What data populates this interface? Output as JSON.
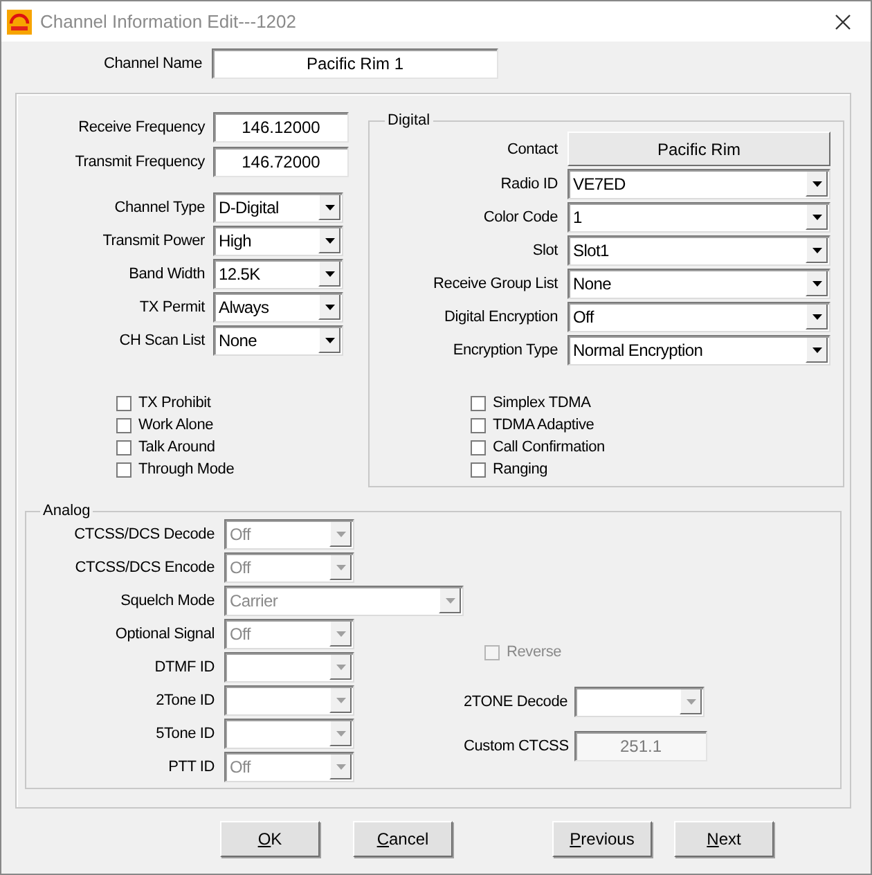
{
  "window": {
    "title": "Channel Information Edit---1202"
  },
  "channel_name": {
    "label": "Channel Name",
    "value": "Pacific Rim 1"
  },
  "frequencies": [
    {
      "label": "Receive Frequency",
      "value": "146.12000"
    },
    {
      "label": "Transmit Frequency",
      "value": "146.72000"
    }
  ],
  "general": [
    {
      "label": "Channel Type",
      "value": "D-Digital"
    },
    {
      "label": "Transmit Power",
      "value": "High"
    },
    {
      "label": "Band Width",
      "value": "12.5K"
    },
    {
      "label": "TX Permit",
      "value": "Always"
    },
    {
      "label": "CH Scan List",
      "value": "None"
    }
  ],
  "general_options": [
    {
      "label": "TX Prohibit",
      "checked": false
    },
    {
      "label": "Work Alone",
      "checked": false
    },
    {
      "label": "Talk Around",
      "checked": false
    },
    {
      "label": "Through Mode",
      "checked": false
    }
  ],
  "digital": {
    "title": "Digital",
    "contact": {
      "label": "Contact",
      "value": "Pacific Rim"
    },
    "fields": [
      {
        "label": "Radio ID",
        "value": "VE7ED"
      },
      {
        "label": "Color Code",
        "value": "1"
      },
      {
        "label": "Slot",
        "value": "Slot1"
      },
      {
        "label": "Receive Group List",
        "value": "None"
      },
      {
        "label": "Digital Encryption",
        "value": "Off"
      },
      {
        "label": "Encryption Type",
        "value": "Normal Encryption"
      }
    ],
    "options": [
      {
        "label": "Simplex TDMA",
        "checked": false
      },
      {
        "label": "TDMA Adaptive",
        "checked": false
      },
      {
        "label": "Call Confirmation",
        "checked": false
      },
      {
        "label": "Ranging",
        "checked": false
      }
    ]
  },
  "analog": {
    "title": "Analog",
    "fields": [
      {
        "label": "CTCSS/DCS Decode",
        "value": "Off",
        "kind": "combo",
        "disabled": true
      },
      {
        "label": "CTCSS/DCS Encode",
        "value": "Off",
        "kind": "combo",
        "disabled": true
      },
      {
        "label": "Squelch Mode",
        "value": "Carrier",
        "kind": "wide",
        "disabled": true
      },
      {
        "label": "Optional Signal",
        "value": "Off",
        "kind": "combo",
        "disabled": true
      },
      {
        "label": "DTMF ID",
        "kind": "combo",
        "disabled": true
      },
      {
        "label": "2Tone ID",
        "kind": "combo",
        "disabled": true
      },
      {
        "label": "5Tone ID",
        "kind": "combo",
        "disabled": true
      },
      {
        "label": "PTT ID",
        "value": "Off",
        "kind": "combo",
        "disabled": true
      }
    ],
    "reverse": {
      "label": "Reverse",
      "checked": false,
      "disabled": true
    },
    "two_tone_decode": {
      "label": "2TONE Decode",
      "disabled": true
    },
    "custom_ctcss": {
      "label": "Custom CTCSS",
      "value": "251.1",
      "disabled": true
    }
  },
  "buttons": [
    {
      "label": "OK"
    },
    {
      "label": "Cancel"
    },
    {
      "label": "Previous"
    },
    {
      "label": "Next"
    }
  ]
}
